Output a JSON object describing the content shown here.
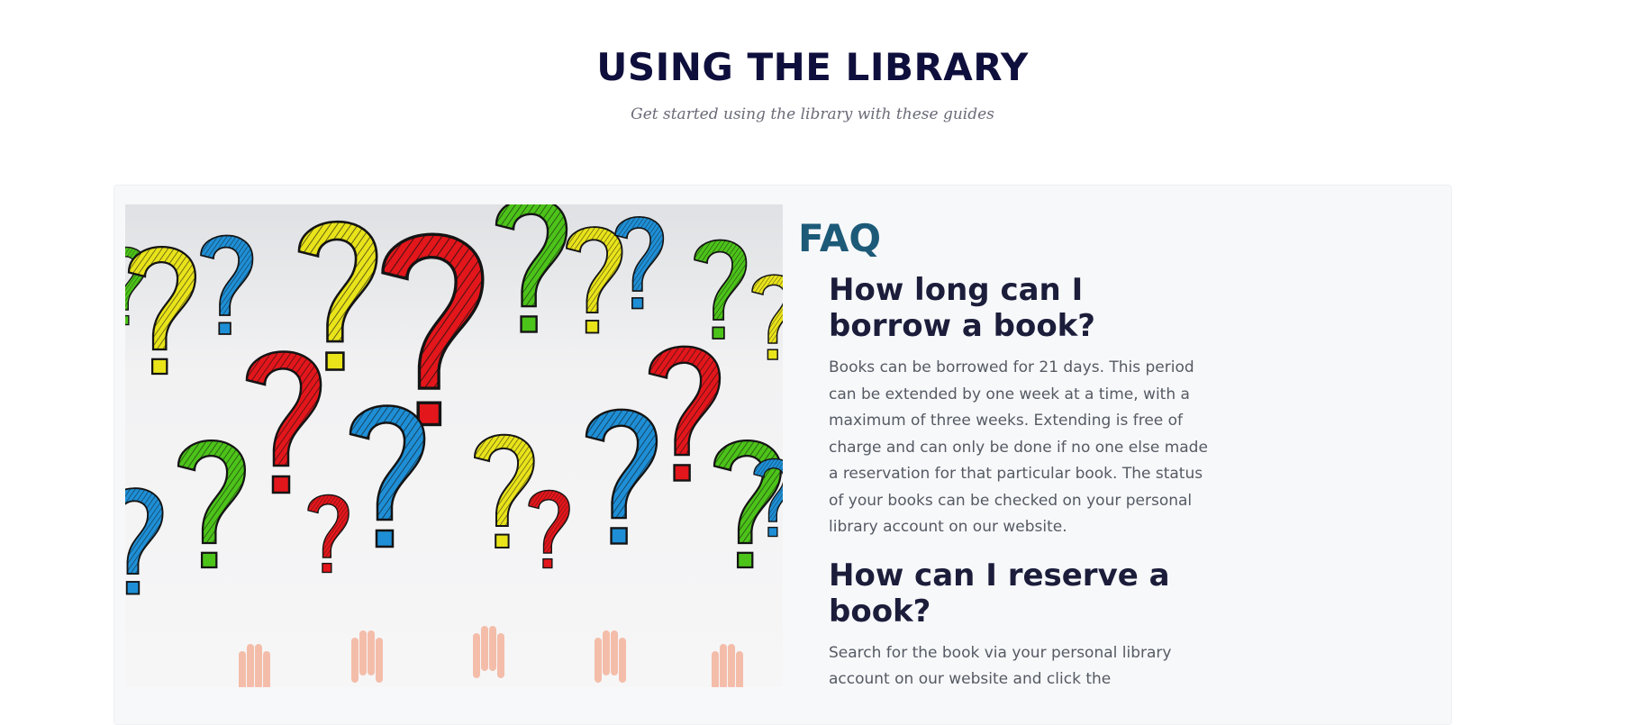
{
  "header": {
    "title": "USING THE LIBRARY",
    "subtitle": "Get started using the library with these guides"
  },
  "image": {
    "subject": "question-marks-and-raised-hands",
    "colors": {
      "red": "#e3161b",
      "blue": "#1e8fd6",
      "green": "#4cc319",
      "yellow": "#e9e31a",
      "skin": "#f3b39c"
    }
  },
  "faq": {
    "title": "FAQ",
    "items": [
      {
        "question": "How long can I borrow a book?",
        "answer": "Books can be borrowed for 21 days. This period can be extended by one week at a time, with a maximum of three weeks. Extending is free of charge and can only be done if no one else made a reservation for that particular book. The status of your books can be checked on your personal library account on our website."
      },
      {
        "question": "How can I reserve a book?",
        "answer": "Search for the book via your personal library account on our website and click the"
      }
    ]
  }
}
